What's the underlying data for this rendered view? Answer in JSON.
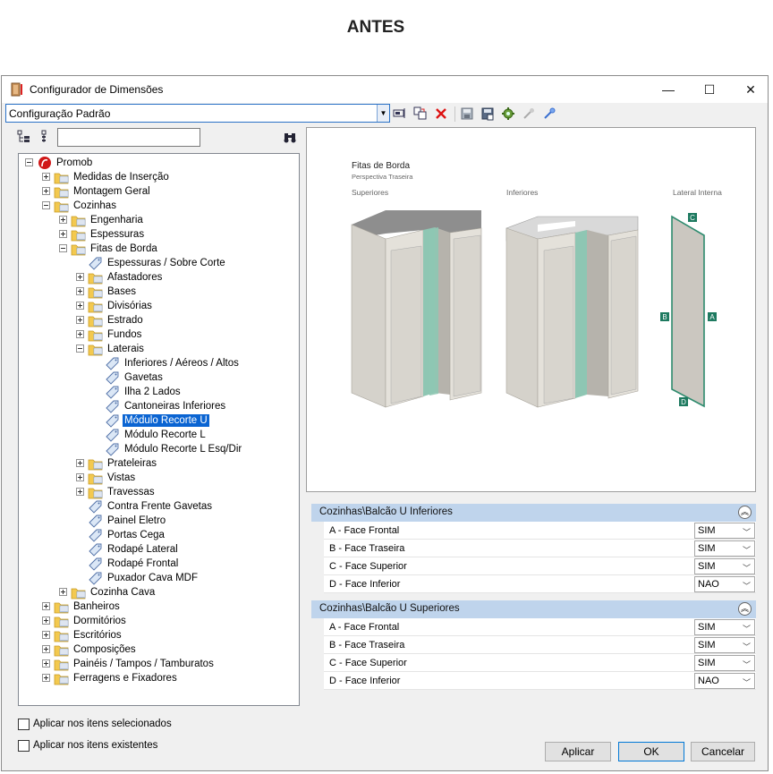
{
  "page_heading": "ANTES",
  "window": {
    "title": "Configurador de Dimensões",
    "controls": {
      "minimize": "—",
      "maximize": "☐",
      "close": "✕"
    }
  },
  "toolbar": {
    "config_value": "Configuração Padrão"
  },
  "tree": {
    "search_value": "",
    "nodes": [
      {
        "label": "Promob",
        "expander": "minus",
        "icon": "promob-logo-icon"
      },
      {
        "label": "Medidas de Inserção",
        "expander": "plus",
        "icon": "folder-icon"
      },
      {
        "label": "Montagem Geral",
        "expander": "plus",
        "icon": "folder-icon"
      },
      {
        "label": "Cozinhas",
        "expander": "minus",
        "icon": "folder-icon"
      },
      {
        "label": "Engenharia",
        "expander": "plus",
        "icon": "folder-icon"
      },
      {
        "label": "Espessuras",
        "expander": "plus",
        "icon": "folder-icon"
      },
      {
        "label": "Fitas de Borda",
        "expander": "minus",
        "icon": "folder-icon"
      },
      {
        "label": "Espessuras / Sobre Corte",
        "expander": "",
        "icon": "tag-icon"
      },
      {
        "label": "Afastadores",
        "expander": "plus",
        "icon": "folder-icon"
      },
      {
        "label": "Bases",
        "expander": "plus",
        "icon": "folder-icon"
      },
      {
        "label": "Divisórias",
        "expander": "plus",
        "icon": "folder-icon"
      },
      {
        "label": "Estrado",
        "expander": "plus",
        "icon": "folder-icon"
      },
      {
        "label": "Fundos",
        "expander": "plus",
        "icon": "folder-icon"
      },
      {
        "label": "Laterais",
        "expander": "minus",
        "icon": "folder-icon"
      },
      {
        "label": "Inferiores / Aéreos / Altos",
        "expander": "",
        "icon": "tag-icon"
      },
      {
        "label": "Gavetas",
        "expander": "",
        "icon": "tag-icon"
      },
      {
        "label": "Ilha 2 Lados",
        "expander": "",
        "icon": "tag-icon"
      },
      {
        "label": "Cantoneiras Inferiores",
        "expander": "",
        "icon": "tag-icon"
      },
      {
        "label": "Módulo Recorte U",
        "expander": "",
        "icon": "tag-icon",
        "selected": true
      },
      {
        "label": "Módulo Recorte L",
        "expander": "",
        "icon": "tag-icon"
      },
      {
        "label": "Módulo Recorte L Esq/Dir",
        "expander": "",
        "icon": "tag-icon"
      },
      {
        "label": "Prateleiras",
        "expander": "plus",
        "icon": "folder-icon"
      },
      {
        "label": "Vistas",
        "expander": "plus",
        "icon": "folder-icon"
      },
      {
        "label": "Travessas",
        "expander": "plus",
        "icon": "folder-icon"
      },
      {
        "label": "Contra Frente Gavetas",
        "expander": "",
        "icon": "tag-icon"
      },
      {
        "label": "Painel Eletro",
        "expander": "",
        "icon": "tag-icon"
      },
      {
        "label": "Portas Cega",
        "expander": "",
        "icon": "tag-icon"
      },
      {
        "label": "Rodapé Lateral",
        "expander": "",
        "icon": "tag-icon"
      },
      {
        "label": "Rodapé Frontal",
        "expander": "",
        "icon": "tag-icon"
      },
      {
        "label": "Puxador Cava MDF",
        "expander": "",
        "icon": "tag-icon"
      },
      {
        "label": "Cozinha Cava",
        "expander": "plus",
        "icon": "folder-icon"
      },
      {
        "label": "Banheiros",
        "expander": "plus",
        "icon": "folder-icon"
      },
      {
        "label": "Dormitórios",
        "expander": "plus",
        "icon": "folder-icon"
      },
      {
        "label": "Escritórios",
        "expander": "plus",
        "icon": "folder-icon"
      },
      {
        "label": "Composições",
        "expander": "plus",
        "icon": "folder-icon"
      },
      {
        "label": "Painéis / Tampos / Tamburatos",
        "expander": "plus",
        "icon": "folder-icon"
      },
      {
        "label": "Ferragens e Fixadores",
        "expander": "plus",
        "icon": "folder-icon"
      }
    ]
  },
  "preview": {
    "title": "Fitas de Borda",
    "subtitle": "Perspectiva Traseira",
    "col_superiores": "Superiores",
    "col_inferiores": "Inferiores",
    "col_lateral": "Lateral Interna",
    "label_a": "A",
    "label_b": "B",
    "label_c": "C",
    "label_d": "D",
    "edge_color": "#2e8b6e"
  },
  "properties": {
    "groups": [
      {
        "title": "Cozinhas\\Balcão U Inferiores",
        "rows": [
          {
            "name": "A - Face Frontal",
            "value": "SIM"
          },
          {
            "name": "B - Face Traseira",
            "value": "SIM"
          },
          {
            "name": "C - Face Superior",
            "value": "SIM"
          },
          {
            "name": "D - Face Inferior",
            "value": "NAO"
          }
        ]
      },
      {
        "title": "Cozinhas\\Balcão U Superiores",
        "rows": [
          {
            "name": "A - Face Frontal",
            "value": "SIM"
          },
          {
            "name": "B - Face Traseira",
            "value": "SIM"
          },
          {
            "name": "C - Face Superior",
            "value": "SIM"
          },
          {
            "name": "D - Face Inferior",
            "value": "NAO"
          }
        ]
      }
    ]
  },
  "options": {
    "apply_selected": "Aplicar nos itens selecionados",
    "apply_existing": "Aplicar nos itens existentes"
  },
  "buttons": {
    "apply": "Aplicar",
    "ok": "OK",
    "cancel": "Cancelar"
  }
}
